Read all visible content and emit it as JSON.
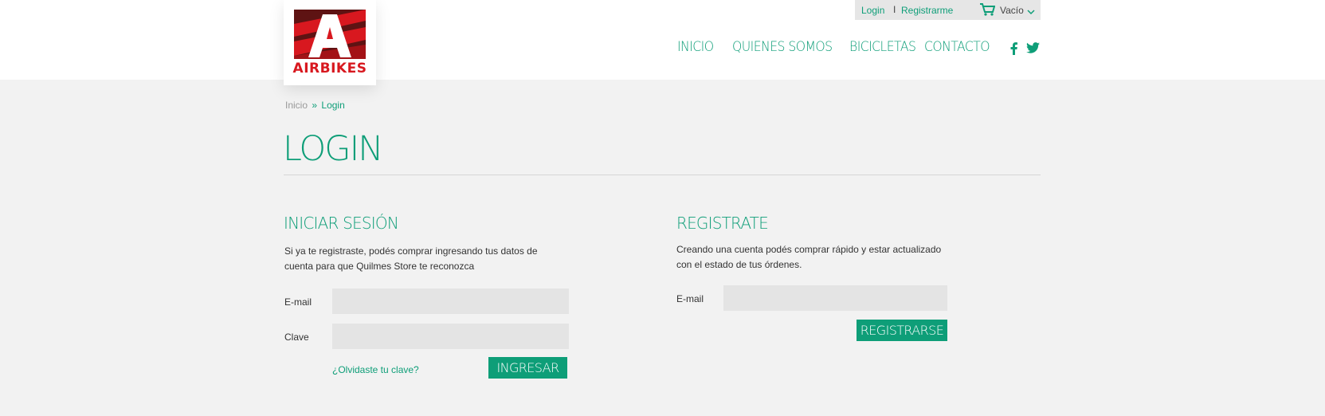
{
  "brand": {
    "name": "AIRBIKES",
    "logo_color": "#d8181f",
    "logo_dark": "#6b1414"
  },
  "topbar": {
    "login_label": "Login",
    "separator": "I",
    "register_label": "Registrarme",
    "cart_label": "Vacío",
    "cart_icon": "cart-icon"
  },
  "nav": {
    "items": [
      {
        "label": "INICIO"
      },
      {
        "label": "QUIENES SOMOS"
      },
      {
        "label": "BICICLETAS"
      },
      {
        "label": "CONTACTO"
      }
    ],
    "social": [
      "facebook-icon",
      "twitter-icon"
    ]
  },
  "breadcrumb": {
    "home": "Inicio",
    "separator": "»",
    "current": "Login"
  },
  "page": {
    "title": "LOGIN"
  },
  "login": {
    "title": "INICIAR SESIÓN",
    "description": "Si ya te registraste, podés comprar ingresando tus datos de cuenta para que Quilmes Store te reconozca",
    "email_label": "E-mail",
    "password_label": "Clave",
    "forgot_label": "¿Olvidaste tu clave?",
    "submit_label": "INGRESAR"
  },
  "register": {
    "title": "REGISTRATE",
    "description": "Creando una cuenta podés comprar rápido y estar actualizado con el estado de tus órdenes.",
    "email_label": "E-mail",
    "submit_label": "REGISTRARSE"
  },
  "colors": {
    "accent": "#0e9e78",
    "background": "#f2f2f2",
    "field": "#e4e4e4"
  }
}
